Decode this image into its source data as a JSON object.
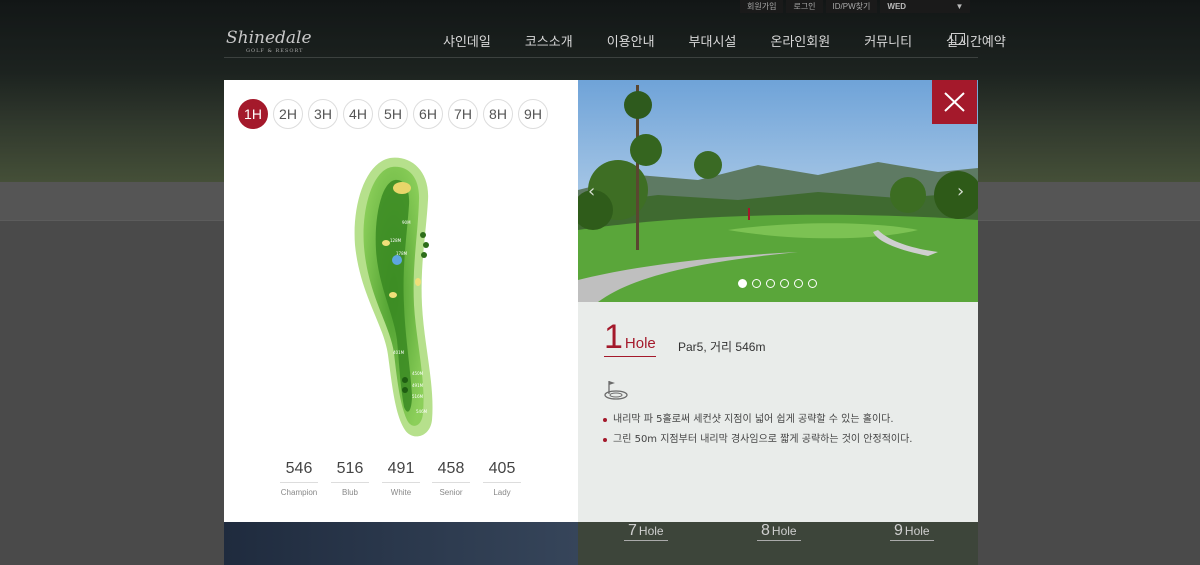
{
  "utility_bar": {
    "join": "회원가입",
    "login": "로그인",
    "find": "ID/PW찾기",
    "day": "WED",
    "caret": "▼"
  },
  "logo": {
    "script": "Shinedale",
    "sub": "GOLF & RESORT"
  },
  "nav": [
    "샤인데일",
    "코스소개",
    "이용안내",
    "부대시설",
    "온라인회원",
    "커뮤니티",
    "실시간예약"
  ],
  "hole_tabs": [
    "1H",
    "2H",
    "3H",
    "4H",
    "5H",
    "6H",
    "7H",
    "8H",
    "9H"
  ],
  "active_tab": 0,
  "map_labels": [
    "90M",
    "128M",
    "178M",
    "401M",
    "450M",
    "491M",
    "516M",
    "546M"
  ],
  "distances": [
    {
      "value": "546",
      "tee": "Champion"
    },
    {
      "value": "516",
      "tee": "Blub"
    },
    {
      "value": "491",
      "tee": "White"
    },
    {
      "value": "458",
      "tee": "Senior"
    },
    {
      "value": "405",
      "tee": "Lady"
    }
  ],
  "slider": {
    "count": 6,
    "active": 0,
    "prev": "‹",
    "next": "›"
  },
  "hole": {
    "number": "1",
    "label": "Hole",
    "info": "Par5, 거리 546m"
  },
  "description": [
    "내리막 파 5홀로써 세컨샷 지점이 넓어 쉽게 공략할 수 있는 홀이다.",
    "그린 50m 지점부터 내리막 경사임으로 짧게 공략하는 것이 안정적이다."
  ],
  "background_thumbs": [
    {
      "num": "7",
      "label": "Hole"
    },
    {
      "num": "8",
      "label": "Hole"
    },
    {
      "num": "9",
      "label": "Hole"
    }
  ],
  "colors": {
    "accent": "#a4192b"
  },
  "icons": {
    "close": "close-icon",
    "calendar": "calendar-icon",
    "flag": "flag-green-icon"
  }
}
